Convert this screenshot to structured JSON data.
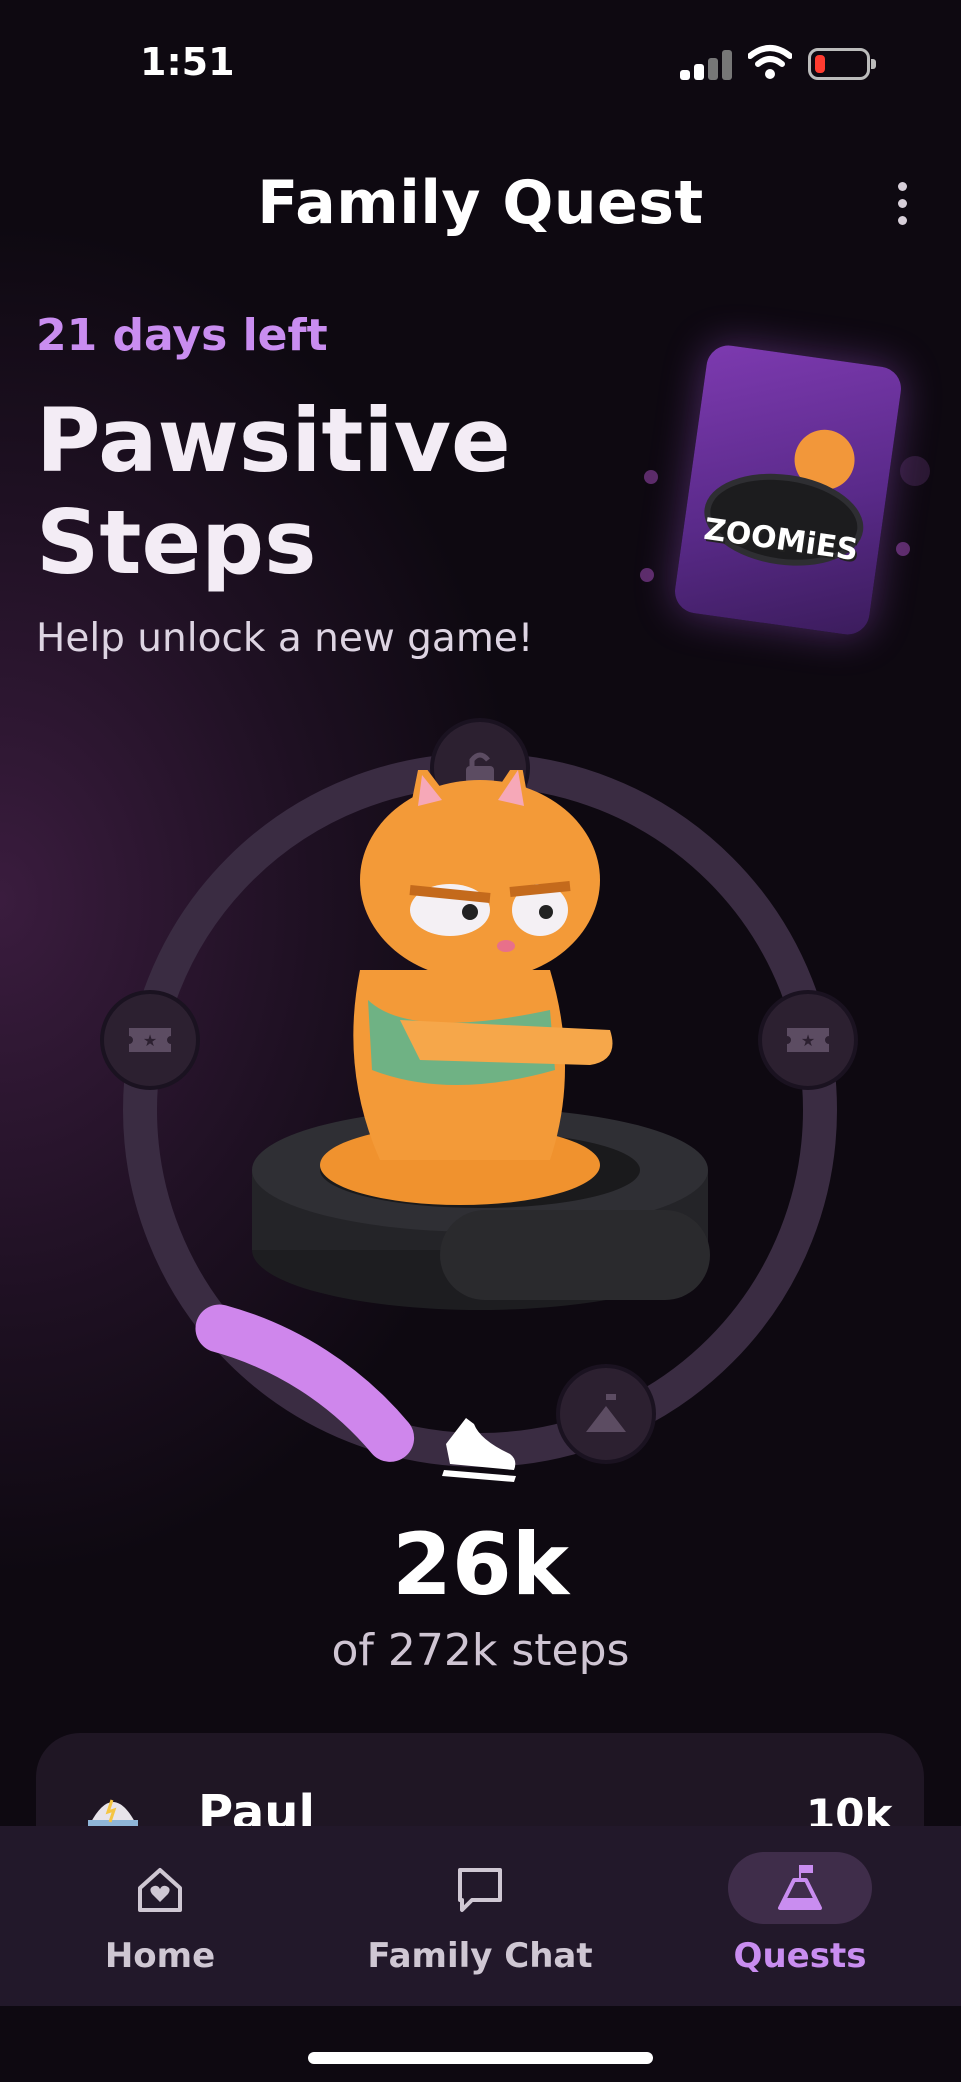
{
  "status_bar": {
    "time": "1:51"
  },
  "header": {
    "title": "Family Quest"
  },
  "quest": {
    "days_left": "21 days left",
    "name_line1": "Pawsitive",
    "name_line2": "Steps",
    "subtitle": "Help unlock a new game!",
    "reward_card_label": "ZOOMiES",
    "progress_fraction": 0.096,
    "steps_done": "26k",
    "steps_total_text": "of 272k steps"
  },
  "member": {
    "name": "Paul",
    "steps": "10k"
  },
  "tabs": [
    {
      "label": "Home",
      "icon": "home-heart-icon"
    },
    {
      "label": "Family Chat",
      "icon": "chat-bubble-icon"
    },
    {
      "label": "Quests",
      "icon": "flask-flag-icon"
    }
  ],
  "colors": {
    "accent": "#c98df0",
    "background": "#0e0911",
    "ring_track": "#3a2c42"
  }
}
